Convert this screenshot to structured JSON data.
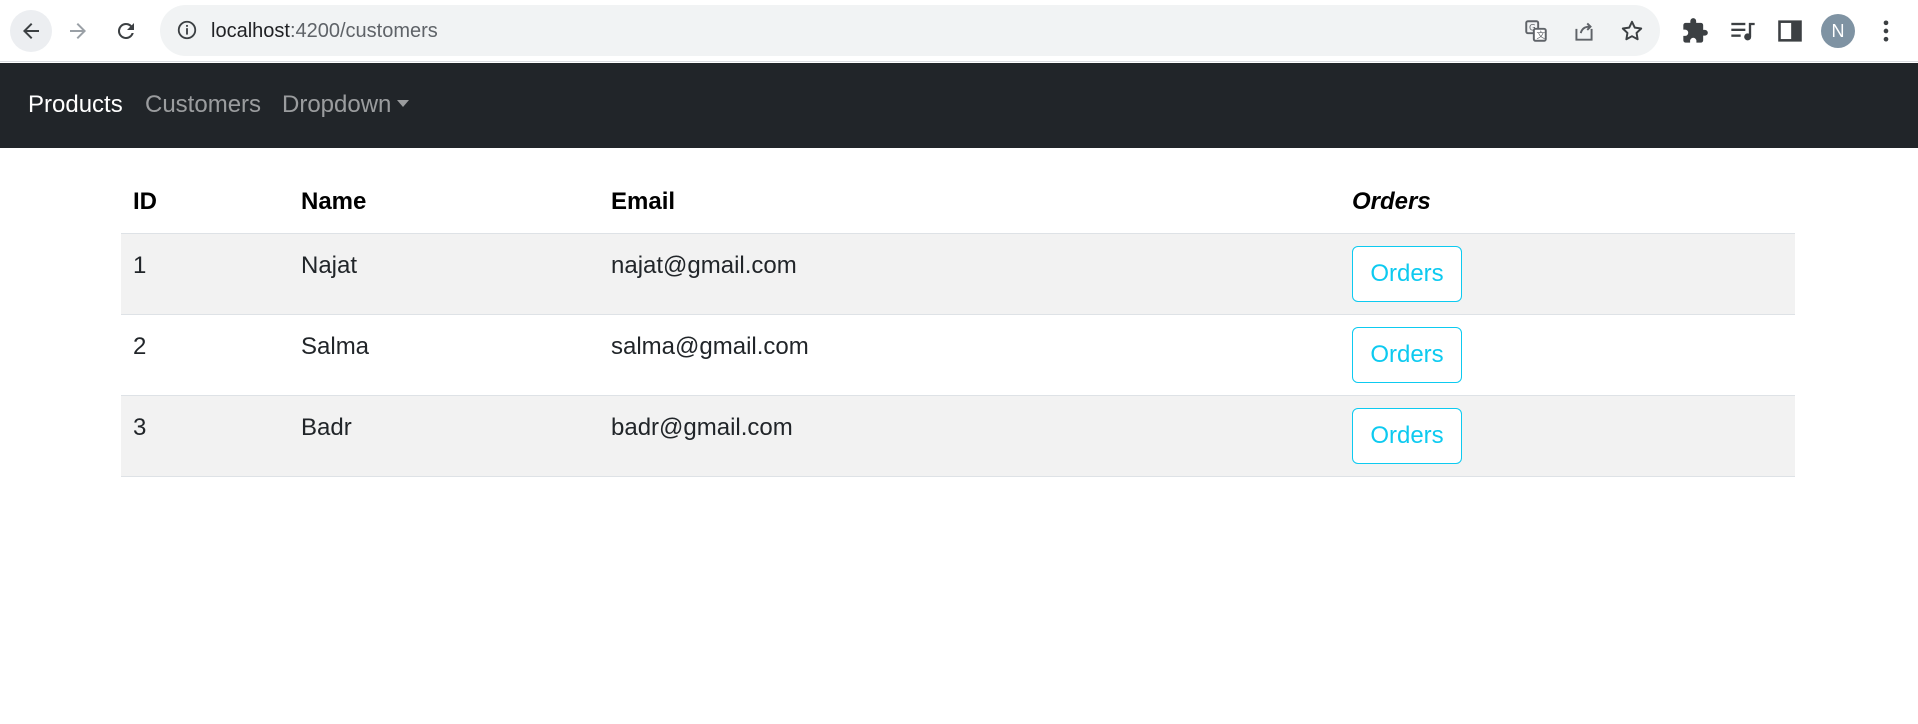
{
  "browser": {
    "url_host": "localhost",
    "url_rest": ":4200/customers",
    "avatar_initial": "N",
    "icons": [
      "back-arrow-icon",
      "forward-arrow-icon",
      "reload-icon",
      "site-info-icon",
      "translate-icon",
      "share-icon",
      "bookmark-star-icon",
      "extensions-icon",
      "media-queue-icon",
      "side-panel-icon",
      "more-vert-icon"
    ]
  },
  "navbar": {
    "items": [
      {
        "label": "Products"
      },
      {
        "label": "Customers"
      },
      {
        "label": "Dropdown"
      }
    ]
  },
  "table": {
    "headers": {
      "id": "ID",
      "name": "Name",
      "email": "Email",
      "orders": "Orders"
    },
    "rows": [
      {
        "id": "1",
        "name": "Najat",
        "email": "najat@gmail.com",
        "action": "Orders"
      },
      {
        "id": "2",
        "name": "Salma",
        "email": "salma@gmail.com",
        "action": "Orders"
      },
      {
        "id": "3",
        "name": "Badr",
        "email": "badr@gmail.com",
        "action": "Orders"
      }
    ]
  },
  "colors": {
    "navbar_bg": "#212529",
    "accent_info": "#0dcaf0",
    "stripe": "#f2f2f2"
  }
}
